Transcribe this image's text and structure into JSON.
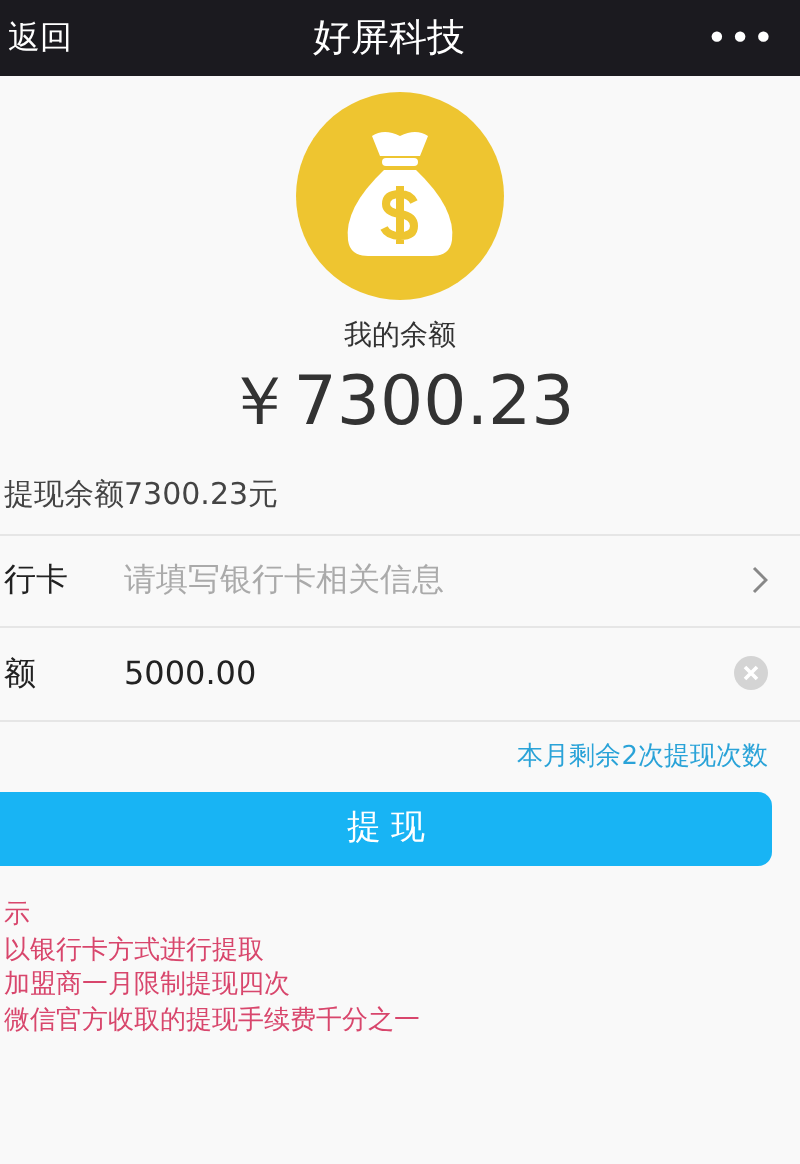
{
  "navbar": {
    "back": "返回",
    "title": "好屏科技",
    "more": "•••"
  },
  "balance": {
    "label": "我的余额",
    "amount": "￥7300.23"
  },
  "available": "提现余额7300.23元",
  "fields": [
    {
      "label": "行卡",
      "placeholder": "请填写银行卡相关信息",
      "kind": "select"
    },
    {
      "label": "额",
      "value": "5000.00",
      "kind": "clearable"
    }
  ],
  "remaining_hint": "本月剩余2次提现次数",
  "submit_button": "提 现",
  "notes": [
    "示",
    "以银行卡方式进行提取",
    "加盟商一月限制提现四次",
    "微信官方收取的提现手续费千分之一"
  ]
}
